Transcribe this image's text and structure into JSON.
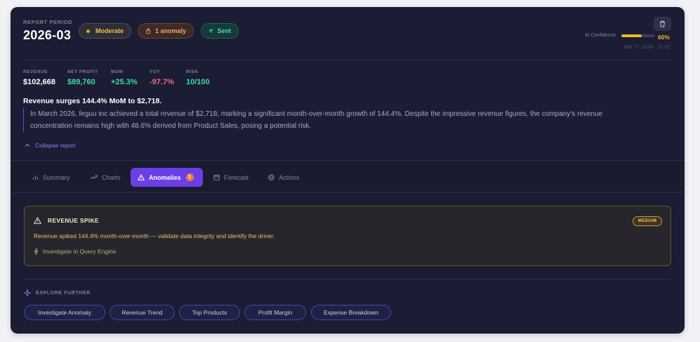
{
  "report": {
    "period_label": "REPORT PERIOD",
    "period_value": "2026-03",
    "badges": {
      "severity": "Moderate",
      "anomalies": "1 anomaly",
      "status": "Sent"
    },
    "confidence": {
      "label": "AI Confidence",
      "value_text": "60%",
      "value": 0.6,
      "date": "Mar 27, 2026 · 12:52"
    }
  },
  "metrics": [
    {
      "label": "REVENUE",
      "value": "$102,668",
      "color": "#ffffff"
    },
    {
      "label": "NET PROFIT",
      "value": "$89,760",
      "color": "#3ddc97"
    },
    {
      "label": "MOM",
      "value": "+25.3%",
      "color": "#3ddc97"
    },
    {
      "label": "YOY",
      "value": "-97.7%",
      "color": "#f26b72"
    },
    {
      "label": "RISK",
      "value": "10/100",
      "color": "#3ddc97"
    }
  ],
  "headline": "Revenue surges 144.4% MoM to $2,718.",
  "summary": "In March 2026, feguu inc achieved a total revenue of $2,718, marking a significant month-over-month growth of 144.4%. Despite the impressive revenue figures, the company's revenue concentration remains high with 48.6% derived from Product Sales, posing a potential risk.",
  "collapse_label": "Collapse report",
  "tabs": [
    {
      "label": "Summary",
      "icon": "bar-chart-icon"
    },
    {
      "label": "Charts",
      "icon": "trend-icon"
    },
    {
      "label": "Anomalies",
      "icon": "warning-icon",
      "count": "1",
      "active": true
    },
    {
      "label": "Forecast",
      "icon": "calendar-icon"
    },
    {
      "label": "Actions",
      "icon": "target-icon"
    }
  ],
  "anomaly": {
    "title": "REVENUE SPIKE",
    "severity": "MEDIUM",
    "description": "Revenue spiked 144.4% month-over-month — validate data integrity and identify the driver.",
    "link": "Investigate in Query Engine"
  },
  "explore": {
    "title": "EXPLORE FURTHER",
    "chips": [
      "Investigate Anomaly",
      "Revenue Trend",
      "Top Products",
      "Profit Margin",
      "Expense Breakdown"
    ]
  },
  "colors": {
    "accent": "#6c3fe6",
    "confidence": "#f0b62d",
    "positive": "#3ddc97",
    "negative": "#f26b72"
  }
}
